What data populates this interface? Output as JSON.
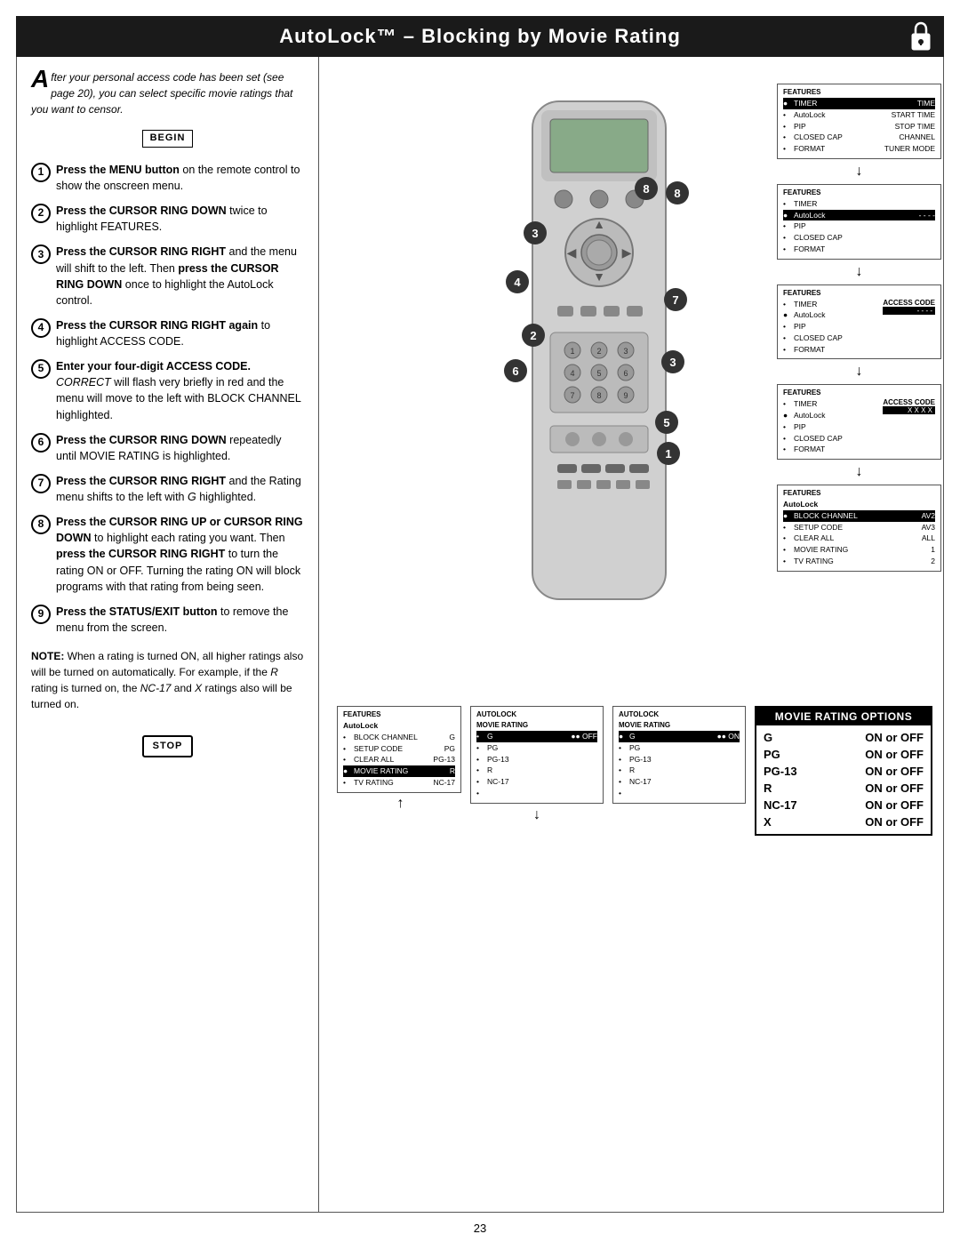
{
  "header": {
    "title": "AutoLock™ – Blocking by Movie Rating",
    "lock_icon": "lock"
  },
  "intro": {
    "drop_cap": "A",
    "text": "fter your personal access code has been set (see page 20), you can select specific movie ratings that you want to censor."
  },
  "begin_label": "BEGIN",
  "stop_label": "STOP",
  "steps": [
    {
      "num": "1",
      "html": "<b>Press the MENU button</b> on the remote control to show the onscreen menu."
    },
    {
      "num": "2",
      "html": "<b>Press the CURSOR RING DOWN</b> twice to highlight FEATURES."
    },
    {
      "num": "3",
      "html": "<b>Press the CURSOR RING RIGHT</b> and the menu will shift to the left. Then <b>press the CURSOR RING DOWN</b> once to highlight the AutoLock control."
    },
    {
      "num": "4",
      "html": "<b>Press the CURSOR RING RIGHT again</b> to highlight ACCESS CODE."
    },
    {
      "num": "5",
      "html": "<b>Enter your four-digit ACCESS CODE.</b> <i>CORRECT</i> will flash very briefly in red and the menu will move to the left with BLOCK CHANNEL highlighted."
    },
    {
      "num": "6",
      "html": "<b>Press the CURSOR RING DOWN</b> repeatedly until MOVIE RATING is highlighted."
    },
    {
      "num": "7",
      "html": "<b>Press the CURSOR RING RIGHT</b> and the Rating menu shifts to the left with <i>G</i> highlighted."
    },
    {
      "num": "8",
      "html": "<b>Press the CURSOR RING UP or CURSOR RING DOWN</b> to highlight each rating you want. Then <b>press the CURSOR RING RIGHT</b> to turn the rating ON or OFF. Turning the rating ON will block programs with that rating from being seen."
    },
    {
      "num": "9",
      "html": "<b>Press the STATUS/EXIT button</b> to remove the menu from the screen."
    }
  ],
  "note": {
    "label": "NOTE:",
    "text": "When a rating is turned ON, all higher ratings also will be turned on automatically. For example, if the <i>R</i> rating is turned on, the <i>NC-17</i> and <i>X</i> ratings also will be turned on."
  },
  "screens": [
    {
      "id": "s1",
      "title": "FEATURES",
      "items": [
        {
          "text": "● TIMER",
          "highlight": true,
          "col2": "TIME"
        },
        {
          "text": "  • AutoLock",
          "col2": ""
        },
        {
          "text": "  • PIP",
          "col2": "STOP TIME"
        },
        {
          "text": "  • CLOSED CAP",
          "col2": "CHANNEL"
        },
        {
          "text": "  • FORMAT",
          "col2": "TUNER MODE"
        }
      ]
    },
    {
      "id": "s2",
      "title": "FEATURES",
      "items": [
        {
          "text": "  • TIMER"
        },
        {
          "text": "● AutoLock",
          "highlight": true,
          "col2": "- - - -"
        },
        {
          "text": "  • PIP"
        },
        {
          "text": "  • CLOSED CAP"
        },
        {
          "text": "  • FORMAT"
        }
      ]
    },
    {
      "id": "s3",
      "title": "FEATURES",
      "items": [
        {
          "text": "  • TIMER",
          "col2": "ACCESS CODE"
        },
        {
          "text": "  ● AutoLock"
        },
        {
          "text": "  • PIP",
          "col2": "- - - -"
        },
        {
          "text": "  • CLOSED CAP"
        },
        {
          "text": "  • FORMAT"
        }
      ],
      "access_label": "ACCESS CODE",
      "access_val": "- - - -"
    },
    {
      "id": "s4",
      "title": "FEATURES",
      "items": [
        {
          "text": "  • TIMER",
          "col2": "ACCESS CODE"
        },
        {
          "text": "  ● AutoLock",
          "col2": "X X X X"
        },
        {
          "text": "  • PIP"
        },
        {
          "text": "  • CLOSED CAP"
        },
        {
          "text": "  • FORMAT"
        }
      ]
    },
    {
      "id": "s5",
      "title": "FEATURES",
      "items": [
        {
          "text": "AutoLock"
        },
        {
          "text": "● BLOCK CHANNEL",
          "highlight": true,
          "col2": "AV2"
        },
        {
          "text": "  • SETUP CODE",
          "col2": "AV3"
        },
        {
          "text": "  • CLEAR ALL",
          "col2": "ALL"
        },
        {
          "text": "  • MOVIE RATING",
          "col2": "1"
        },
        {
          "text": "  • TV RATING",
          "col2": "2"
        }
      ]
    }
  ],
  "bottom_screens": [
    {
      "id": "bs1",
      "title": "FEATURES",
      "sub": "AutoLock",
      "items": [
        {
          "text": "  • BLOCK CHANNEL",
          "col2": "G"
        },
        {
          "text": "  • SETUP CODE",
          "col2": "PG"
        },
        {
          "text": "  • CLEAR ALL",
          "col2": "PG-13"
        },
        {
          "text": "● MOVIE RATING",
          "highlight": true,
          "col2": "R"
        },
        {
          "text": "  • TV RATING",
          "col2": "NC-17"
        }
      ]
    },
    {
      "id": "bs2",
      "title": "AutoLock",
      "sub": "MOVIE RATING",
      "items": [
        {
          "text": "  • G",
          "highlight": true,
          "col2": "●● OFF"
        },
        {
          "text": "  • PG"
        },
        {
          "text": "  • PG-13"
        },
        {
          "text": "  • R"
        },
        {
          "text": "  • NC-17"
        }
      ]
    }
  ],
  "bottom_screen_prev": {
    "title": "AutoLock",
    "sub": "MOVIE RATING",
    "items": [
      {
        "text": "● G",
        "highlight": true,
        "col2": "●● ON"
      },
      {
        "text": "  • PG"
      },
      {
        "text": "  • PG-13"
      },
      {
        "text": "  • R"
      },
      {
        "text": "  • NC-17"
      }
    ]
  },
  "rating_table": {
    "header": "MOVIE RATING OPTIONS",
    "rows": [
      {
        "label": "G",
        "value": "ON or OFF"
      },
      {
        "label": "PG",
        "value": "ON or OFF"
      },
      {
        "label": "PG-13",
        "value": "ON or OFF"
      },
      {
        "label": "R",
        "value": "ON or OFF"
      },
      {
        "label": "NC-17",
        "value": "ON or OFF"
      },
      {
        "label": "X",
        "value": "ON or OFF"
      }
    ]
  },
  "page_number": "23"
}
